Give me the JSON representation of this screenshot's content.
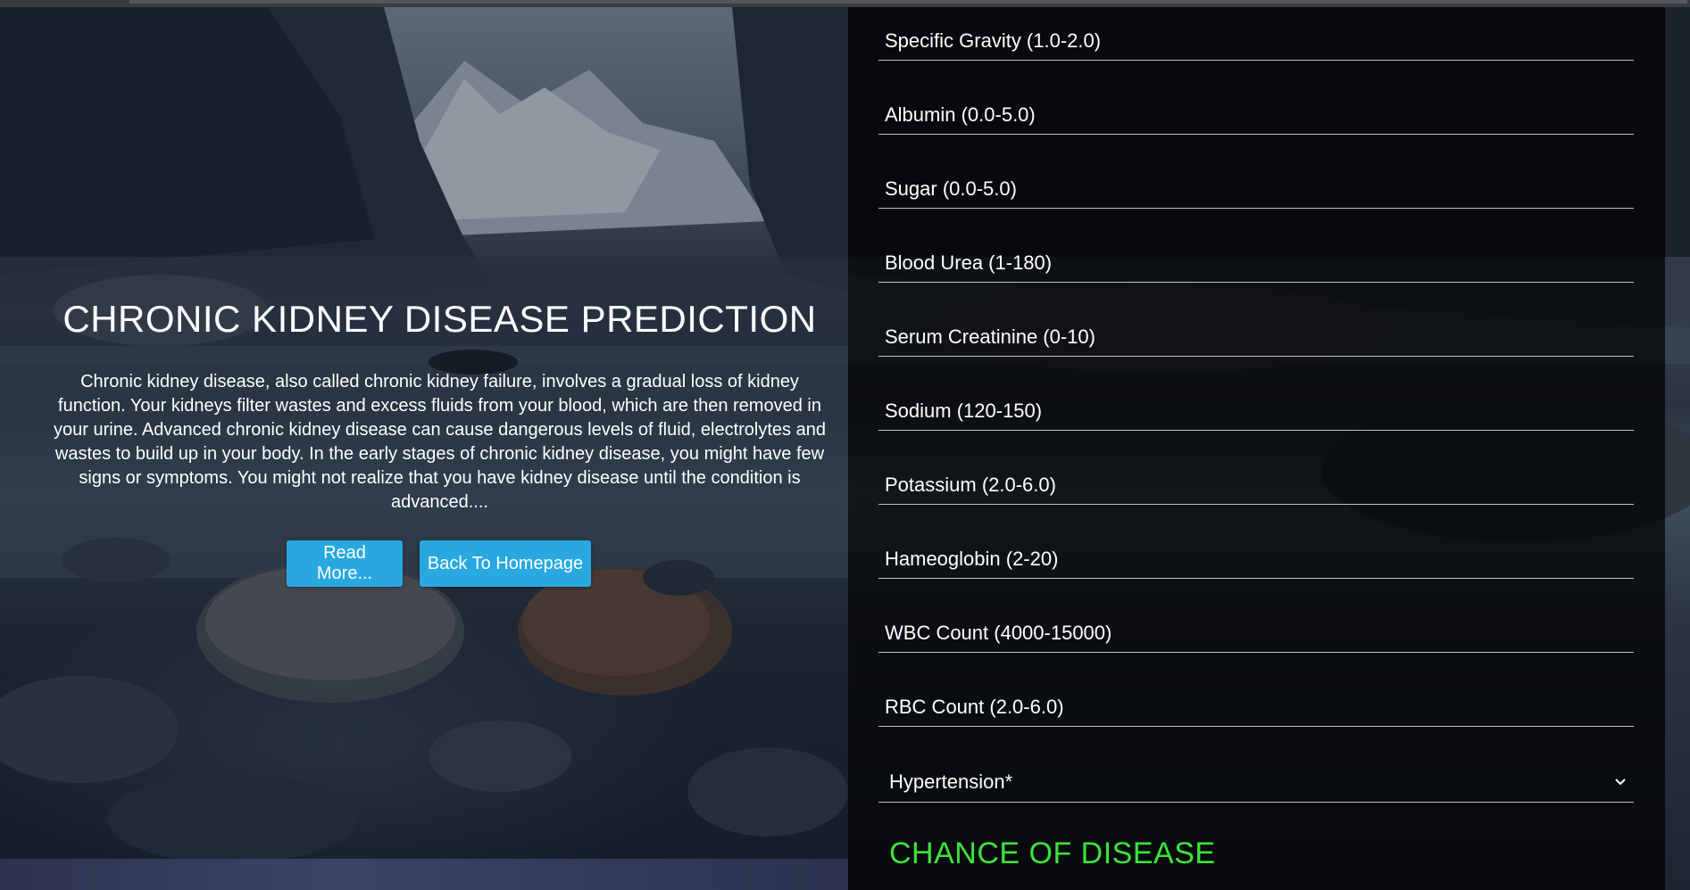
{
  "hero": {
    "title": "CHRONIC KIDNEY DISEASE PREDICTION",
    "description": "Chronic kidney disease, also called chronic kidney failure, involves a gradual loss of kidney function. Your kidneys filter wastes and excess fluids from your blood, which are then removed in your urine. Advanced chronic kidney disease can cause dangerous levels of fluid, electrolytes and wastes to build up in your body. In the early stages of chronic kidney disease, you might have few signs or symptoms. You might not realize that you have kidney disease until the condition is advanced....",
    "read_more_label": "Read More...",
    "back_home_label": "Back To Homepage"
  },
  "form": {
    "fields": [
      {
        "placeholder": "Specific Gravity (1.0-2.0)",
        "value": ""
      },
      {
        "placeholder": "Albumin (0.0-5.0)",
        "value": ""
      },
      {
        "placeholder": "Sugar (0.0-5.0)",
        "value": ""
      },
      {
        "placeholder": "Blood Urea (1-180)",
        "value": ""
      },
      {
        "placeholder": "Serum Creatinine (0-10)",
        "value": ""
      },
      {
        "placeholder": "Sodium (120-150)",
        "value": ""
      },
      {
        "placeholder": "Potassium (2.0-6.0)",
        "value": ""
      },
      {
        "placeholder": "Hameoglobin (2-20)",
        "value": ""
      },
      {
        "placeholder": "WBC Count (4000-15000)",
        "value": ""
      },
      {
        "placeholder": "RBC Count (2.0-6.0)",
        "value": ""
      }
    ],
    "hypertension_select": {
      "selected": "Hypertension*",
      "icon": "chevron-down-icon"
    },
    "result_title": "CHANCE OF DISEASE"
  },
  "colors": {
    "button_bg": "#29a8e0",
    "result_text": "#3ee23a",
    "panel_bg": "rgba(0,0,0,0.72)"
  }
}
